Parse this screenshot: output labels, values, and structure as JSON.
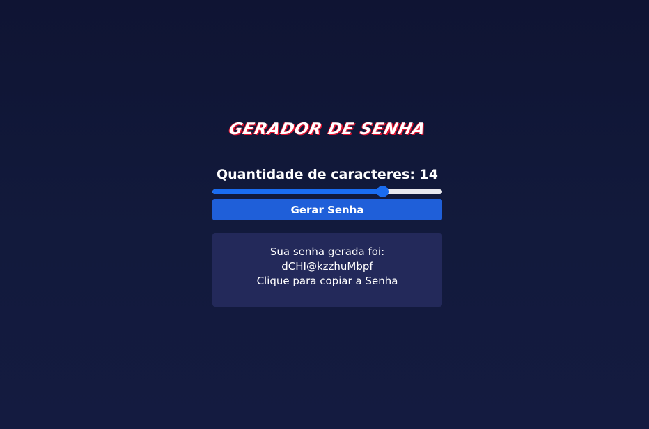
{
  "header": {
    "title": "GERADOR DE SENHA"
  },
  "length": {
    "label": "Quantidade de caracteres: 14",
    "value": 14,
    "slider_fraction": 0.74
  },
  "actions": {
    "generate_label": "Gerar Senha"
  },
  "result": {
    "intro": "Sua senha gerada foi:",
    "password": "dCHI@kzzhuMbpf",
    "copy_hint": "Clique para copiar a Senha"
  },
  "colors": {
    "background": "#0f1433",
    "accent": "#1a6cf0",
    "button": "#1f5fd9",
    "result_box": "#23295a",
    "title_shadow": "#e0122f"
  }
}
